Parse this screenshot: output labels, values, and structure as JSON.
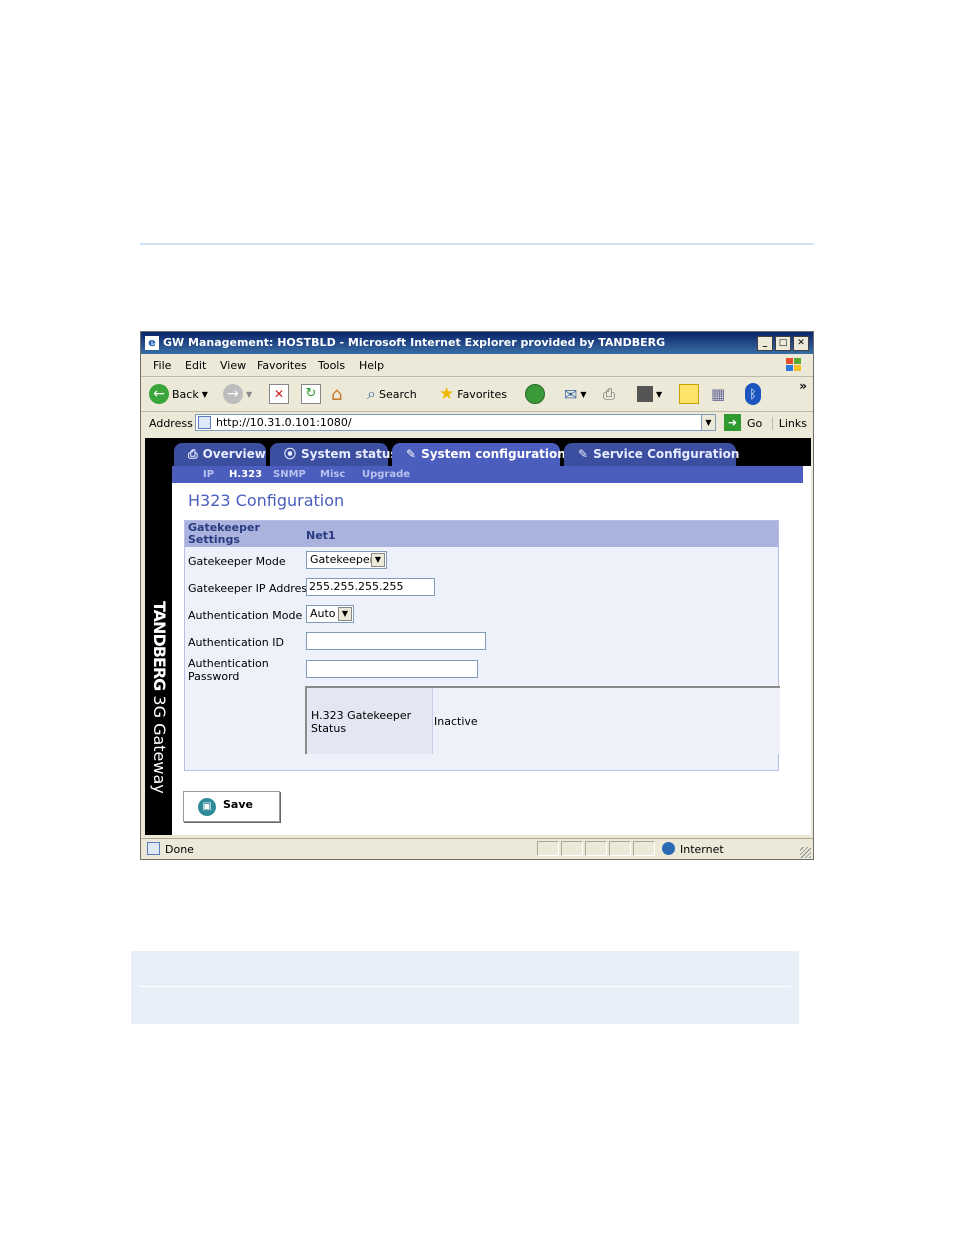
{
  "window": {
    "title": "GW Management: HOSTBLD - Microsoft Internet Explorer provided by TANDBERG",
    "controls": [
      "_",
      "□",
      "✕"
    ]
  },
  "menu": [
    "File",
    "Edit",
    "View",
    "Favorites",
    "Tools",
    "Help"
  ],
  "toolbar": {
    "back": "Back",
    "search": "Search",
    "favorites": "Favorites",
    "overflow": "»"
  },
  "address": {
    "label": "Address",
    "url": "http://10.31.0.101:1080/",
    "go": "Go",
    "links": "Links"
  },
  "brand": {
    "name": "TANDBERG",
    "product": "3G Gateway"
  },
  "tabs": [
    {
      "icon": "⎙",
      "label": "Overview"
    },
    {
      "icon": "⦿",
      "label": "System status"
    },
    {
      "icon": "✎",
      "label": "System configuration"
    },
    {
      "icon": "✎",
      "label": "Service Configuration"
    }
  ],
  "active_tab": "System configuration",
  "subnav": [
    "IP",
    "H.323",
    "SNMP",
    "Misc",
    "Upgrade"
  ],
  "active_subnav": "H.323",
  "page_title": "H323 Configuration",
  "panel": {
    "header_label": "Gatekeeper Settings",
    "header_col": "Net1",
    "fields": {
      "gatekeeper_mode": {
        "label": "Gatekeeper Mode",
        "value": "Gatekeeper"
      },
      "gatekeeper_ip": {
        "label": "Gatekeeper IP Address",
        "value": "255.255.255.255"
      },
      "auth_mode": {
        "label": "Authentication Mode",
        "value": "Auto"
      },
      "auth_id": {
        "label": "Authentication ID",
        "value": ""
      },
      "auth_password": {
        "label": "Authentication Password",
        "value": ""
      }
    },
    "status": {
      "label": "H.323 Gatekeeper Status",
      "value": "Inactive"
    }
  },
  "save_label": "Save",
  "statusbar": {
    "left": "Done",
    "zone": "Internet"
  }
}
